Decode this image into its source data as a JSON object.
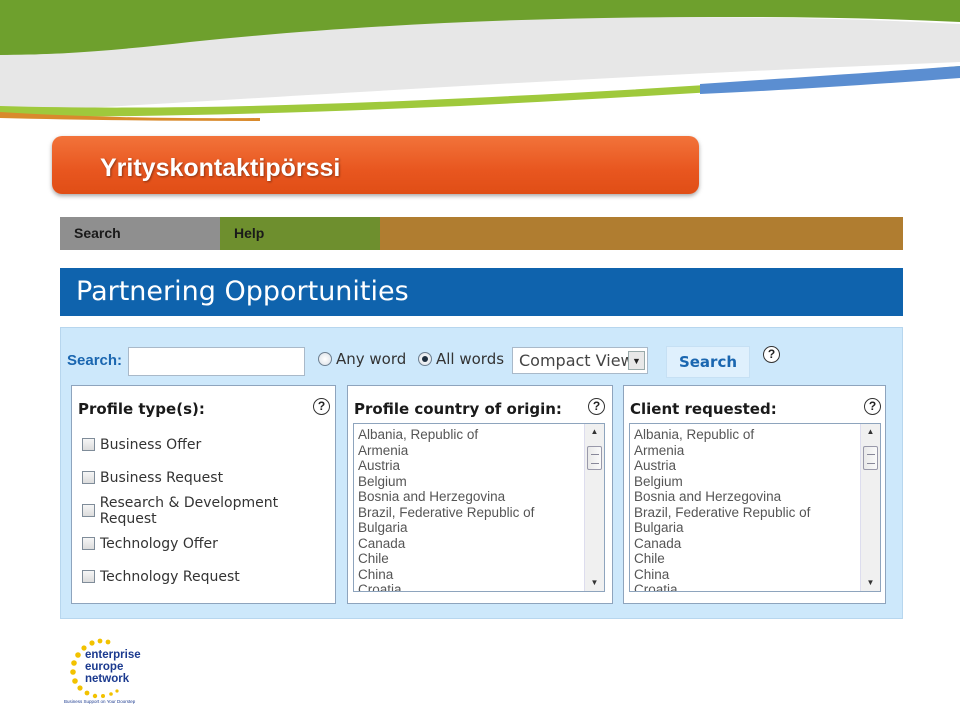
{
  "banner": {
    "title": "Yrityskontaktipörssi"
  },
  "nav": {
    "search": "Search",
    "help": "Help"
  },
  "header": {
    "title": "Partnering Opportunities"
  },
  "search": {
    "label": "Search:",
    "input_value": "",
    "radio_any": "Any word",
    "radio_all": "All words",
    "selected_mode": "All words",
    "view": "Compact View",
    "button": "Search"
  },
  "profile_types": {
    "title": "Profile type(s):",
    "items": [
      "Business Offer",
      "Business Request",
      "Research & Development Request",
      "Technology Offer",
      "Technology Request"
    ]
  },
  "country_origin": {
    "title": "Profile country of origin:",
    "items": [
      "Albania, Republic of",
      "Armenia",
      "Austria",
      "Belgium",
      "Bosnia and Herzegovina",
      "Brazil, Federative Republic of",
      "Bulgaria",
      "Canada",
      "Chile",
      "China",
      "Croatia"
    ]
  },
  "client_requested": {
    "title": "Client requested:",
    "items": [
      "Albania, Republic of",
      "Armenia",
      "Austria",
      "Belgium",
      "Bosnia and Herzegovina",
      "Brazil, Federative Republic of",
      "Bulgaria",
      "Canada",
      "Chile",
      "China",
      "Croatia"
    ]
  },
  "logo": {
    "line1": "enterprise",
    "line2": "europe",
    "line3": "network",
    "tagline": "Business Support on Your Doorstep"
  },
  "colors": {
    "banner": "#e8561f",
    "header": "#0f63ad",
    "panel": "#cde8fb",
    "nav_search": "#8f8f8f",
    "nav_help": "#6e8f2e",
    "nav_rest": "#b07d30"
  },
  "icons": {
    "help": "question-circle-icon",
    "dropdown": "chevron-down-icon"
  }
}
